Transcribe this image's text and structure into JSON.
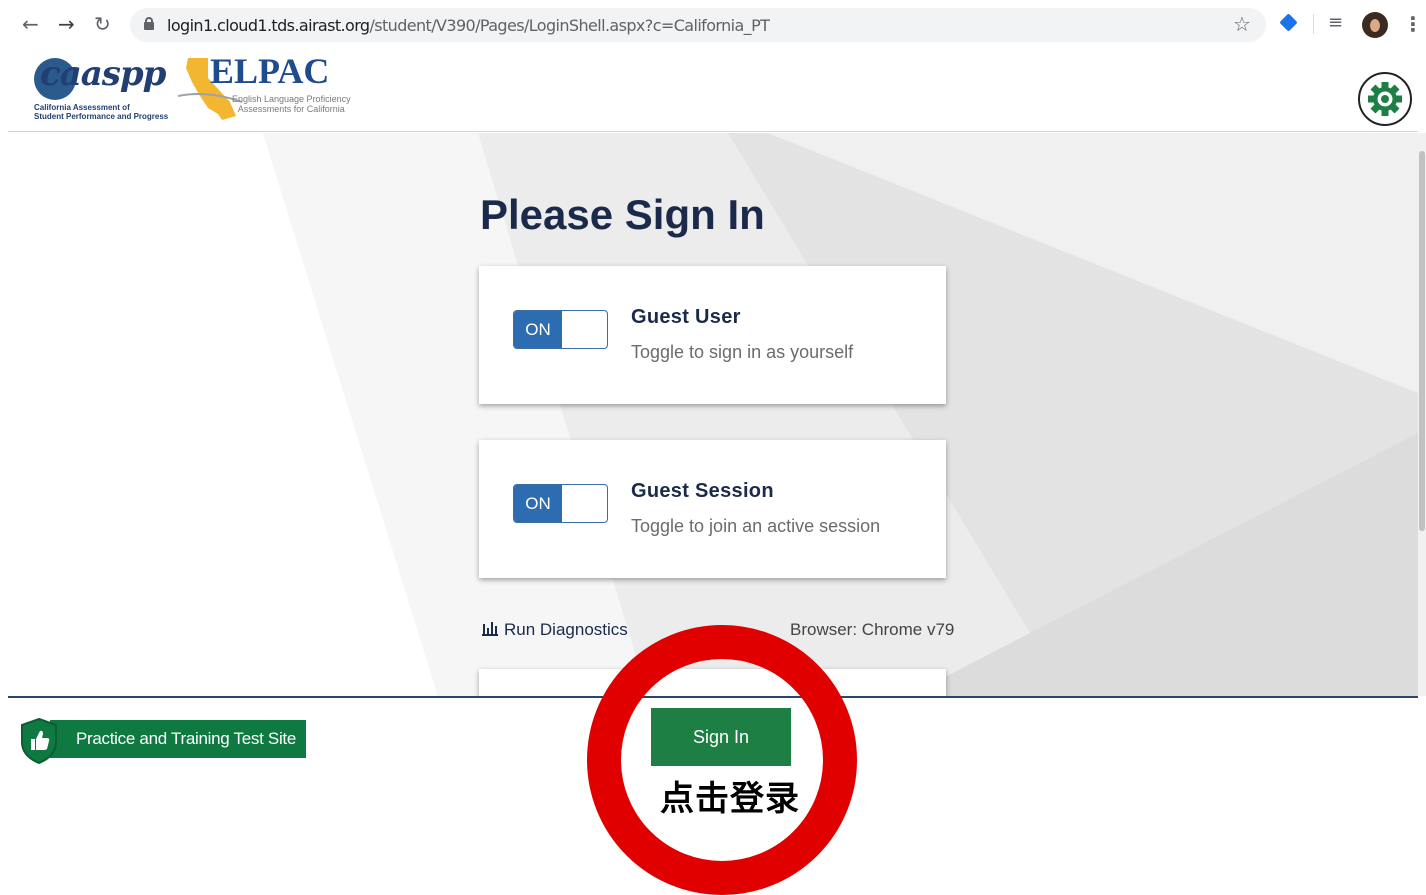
{
  "browser": {
    "url_host": "login1.cloud1.tds.airast.org",
    "url_path": "/student/V390/Pages/LoginShell.aspx?c=California_PT"
  },
  "header": {
    "caaspp_logo_text": "caaspp",
    "caaspp_subtitle_line1": "California Assessment of",
    "caaspp_subtitle_line2": "Student Performance and Progress",
    "elpac_logo_text": "ELPAC",
    "elpac_subtitle_line1": "English Language Proficiency",
    "elpac_subtitle_line2": "Assessments for California"
  },
  "main": {
    "heading": "Please Sign In",
    "cards": [
      {
        "toggle_label": "ON",
        "title": "Guest User",
        "subtitle": "Toggle to sign in as yourself"
      },
      {
        "toggle_label": "ON",
        "title": "Guest Session",
        "subtitle": "Toggle to join an active session"
      }
    ],
    "diagnostics_label": "Run Diagnostics",
    "browser_info": "Browser: Chrome v79"
  },
  "footer": {
    "practice_label": "Practice and Training Test Site",
    "signin_label": "Sign In"
  },
  "annotation": {
    "text": "点击登录"
  },
  "colors": {
    "primary_green": "#1e7f45",
    "toggle_blue": "#2d6cb0",
    "heading_navy": "#1b2a4a",
    "annotation_red": "#e00000"
  }
}
